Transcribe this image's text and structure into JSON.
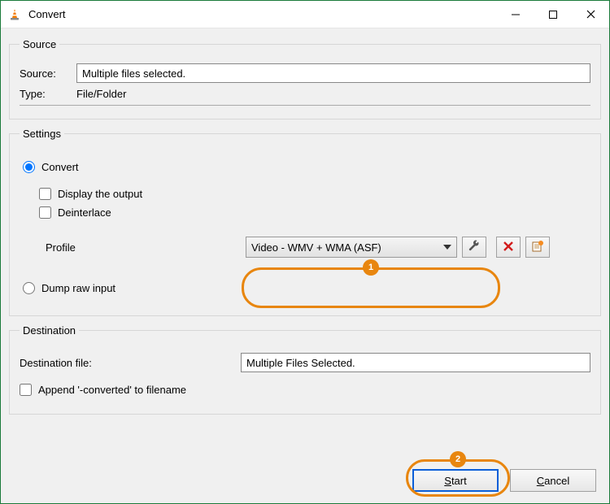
{
  "window": {
    "title": "Convert"
  },
  "source_group": {
    "legend": "Source",
    "source_label": "Source:",
    "source_value": "Multiple files selected.",
    "type_label": "Type:",
    "type_value": "File/Folder"
  },
  "settings_group": {
    "legend": "Settings",
    "convert_label": "Convert",
    "display_output_label": "Display the output",
    "deinterlace_label": "Deinterlace",
    "profile_label": "Profile",
    "profile_value": "Video - WMV + WMA (ASF)",
    "dump_label": "Dump raw input"
  },
  "destination_group": {
    "legend": "Destination",
    "dest_file_label": "Destination file:",
    "dest_file_value": "Multiple Files Selected.",
    "append_label": "Append '-converted' to filename"
  },
  "footer": {
    "start_mn": "S",
    "start_rest": "tart",
    "cancel_mn": "C",
    "cancel_rest": "ancel"
  },
  "annotations": {
    "badge1": "1",
    "badge2": "2"
  }
}
